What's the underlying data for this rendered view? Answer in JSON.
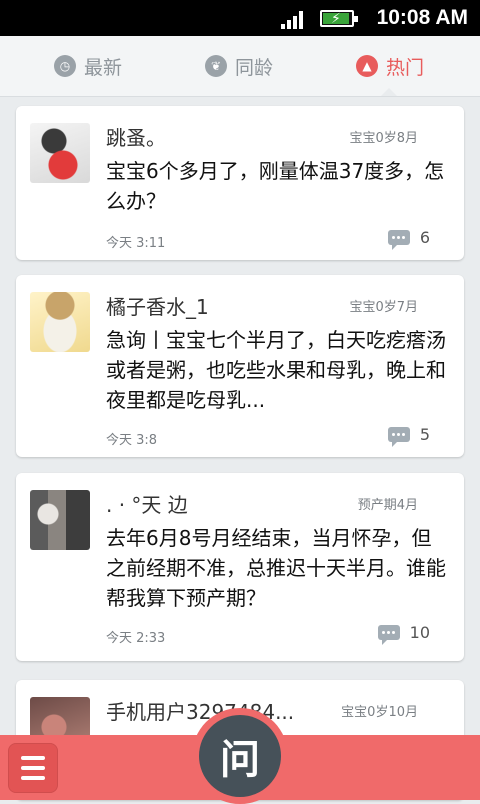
{
  "status_bar": {
    "time": "10:08 AM",
    "signal": "signal-bars-icon",
    "battery": "battery-charging-icon"
  },
  "tabs": [
    {
      "label": "最新",
      "icon": "clock-icon",
      "active": false
    },
    {
      "label": "同龄",
      "icon": "leaf-icon",
      "active": false
    },
    {
      "label": "热门",
      "icon": "fire-icon",
      "active": true
    }
  ],
  "colors": {
    "accent": "#e85c5c",
    "bottom_bar": "#f06a6a",
    "ask_button": "#465159"
  },
  "posts": [
    {
      "username": "跳蚤。",
      "baby_age": "宝宝0岁8月",
      "question": "宝宝6个多月了，刚量体温37度多，怎么办？",
      "time": "今天 3:11",
      "comments": "6"
    },
    {
      "username": "橘子香水_1",
      "baby_age": "宝宝0岁7月",
      "question": "急询丨宝宝七个半月了，白天吃疙瘩汤或者是粥，也吃些水果和母乳，晚上和夜里都是吃母乳...",
      "time": "今天 3:8",
      "comments": "5"
    },
    {
      "username": ". · °天 边",
      "baby_age": "预产期4月",
      "question": "去年6月8号月经结束，当月怀孕，但之前经期不准，总推迟十天半月。谁能帮我算下预产期？",
      "time": "今天 2:33",
      "comments": "10"
    },
    {
      "username": "手机用户3297484...",
      "baby_age": "宝宝0岁10月"
    }
  ],
  "bottom_bar": {
    "menu_icon": "hamburger-menu-icon",
    "ask_label": "问"
  }
}
